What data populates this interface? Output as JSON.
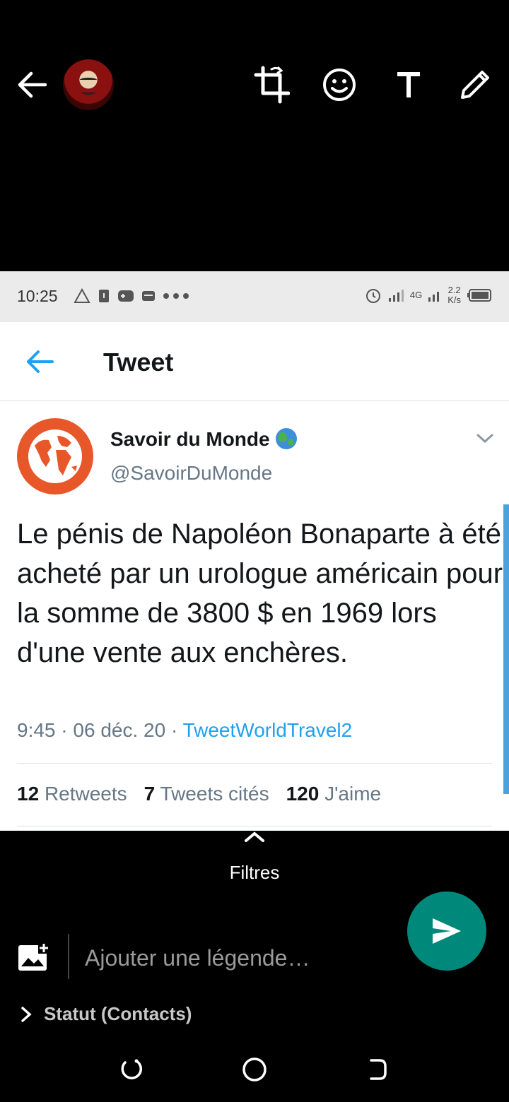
{
  "inner_status": {
    "time": "10:25",
    "network": "4G",
    "speed_value": "2.2",
    "speed_unit": "K/s"
  },
  "tweet_screen": {
    "title": "Tweet",
    "author": {
      "name": "Savoir du Monde",
      "handle": "@SavoirDuMonde"
    },
    "text": "Le pénis de Napoléon Bonaparte à été acheté par un urologue américain pour la somme de 3800 $ en 1969 lors d'une vente aux enchères.",
    "meta": {
      "time": "9:45",
      "sep1": " · ",
      "date": "06 déc. 20",
      "sep2": " · ",
      "source": "TweetWorldTravel2"
    },
    "stats": [
      {
        "count": "12",
        "label": "Retweets"
      },
      {
        "count": "7",
        "label": "Tweets cités"
      },
      {
        "count": "120",
        "label": "J'aime"
      }
    ]
  },
  "editor": {
    "filters_label": "Filtres",
    "caption_placeholder": "Ajouter une légende…",
    "status_label": "Statut (Contacts)"
  },
  "colors": {
    "twitter_blue": "#1da1f2",
    "send_green": "#00897b",
    "profile_orange": "#e8572a"
  },
  "icons": [
    "back-arrow-icon",
    "crop-rotate-icon",
    "emoji-icon",
    "text-icon",
    "pencil-icon",
    "send-icon",
    "add-media-icon",
    "chevron-right-icon"
  ]
}
